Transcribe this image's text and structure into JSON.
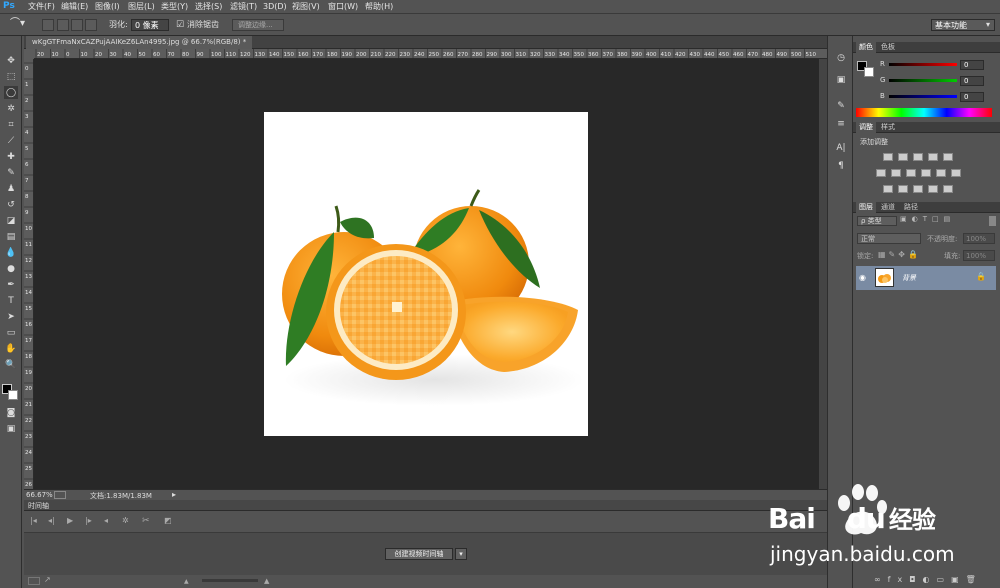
{
  "app": {
    "logo": "Ps"
  },
  "menu": [
    "文件(F)",
    "编辑(E)",
    "图像(I)",
    "图层(L)",
    "类型(Y)",
    "选择(S)",
    "滤镜(T)",
    "3D(D)",
    "视图(V)",
    "窗口(W)",
    "帮助(H)"
  ],
  "options": {
    "feather_label": "羽化:",
    "feather_value": "0 像素",
    "antialias_label": "消除锯齿",
    "refine_edge": "调整边缘...",
    "workspace": "基本功能"
  },
  "document": {
    "tab_title": "wKgGTFmaNxCAZPujAAIKeZ6LAn4995.jpg @ 66.7%(RGB/8) *",
    "zoom": "66.67%",
    "doc_size": "文档:1.83M/1.83M"
  },
  "ruler_h": [
    "20",
    "10",
    "0",
    "10",
    "20",
    "30",
    "40",
    "50",
    "60",
    "70",
    "80",
    "90",
    "100",
    "110",
    "120",
    "130",
    "140",
    "150",
    "160",
    "170",
    "180",
    "190",
    "200",
    "210",
    "220",
    "230",
    "240",
    "250",
    "260",
    "270",
    "280",
    "290",
    "300",
    "310",
    "320",
    "330",
    "340",
    "350",
    "360",
    "370",
    "380",
    "390",
    "400",
    "410",
    "420",
    "430",
    "440",
    "450",
    "460",
    "470",
    "480",
    "490",
    "500",
    "510"
  ],
  "ruler_v": [
    "0",
    "1",
    "2",
    "3",
    "4",
    "5",
    "6",
    "7",
    "8",
    "9",
    "10",
    "11",
    "12",
    "13",
    "14",
    "15",
    "16",
    "17",
    "18",
    "19",
    "20",
    "21",
    "22",
    "23",
    "24",
    "25",
    "26"
  ],
  "timeline": {
    "title": "时间轴",
    "create_button": "创建视频时间轴"
  },
  "color_panel": {
    "tabs": [
      "颜色",
      "色板"
    ],
    "channels": [
      {
        "label": "R",
        "value": "0"
      },
      {
        "label": "G",
        "value": "0"
      },
      {
        "label": "B",
        "value": "0"
      }
    ]
  },
  "adjustments_panel": {
    "tabs": [
      "调整",
      "样式"
    ],
    "add_label": "添加调整"
  },
  "layers_panel": {
    "tabs": [
      "图层",
      "通道",
      "路径"
    ],
    "kind_filter": "ρ 类型",
    "blend_mode": "正常",
    "opacity_label": "不透明度:",
    "opacity_value": "100%",
    "lock_label": "锁定:",
    "fill_label": "填充:",
    "fill_value": "100%",
    "layers": [
      {
        "name": "背景",
        "locked": true,
        "visible": true
      }
    ]
  },
  "watermark": {
    "brand_latin": "Bai",
    "brand_latin2": "du",
    "brand_cn": "经验",
    "url": "jingyan.baidu.com"
  },
  "colors": {
    "ui_bg": "#535353",
    "canvas_bg": "#282828",
    "orange": "#f59a14",
    "leaf": "#2f7d24",
    "layer_highlight": "#7a8ba3"
  }
}
